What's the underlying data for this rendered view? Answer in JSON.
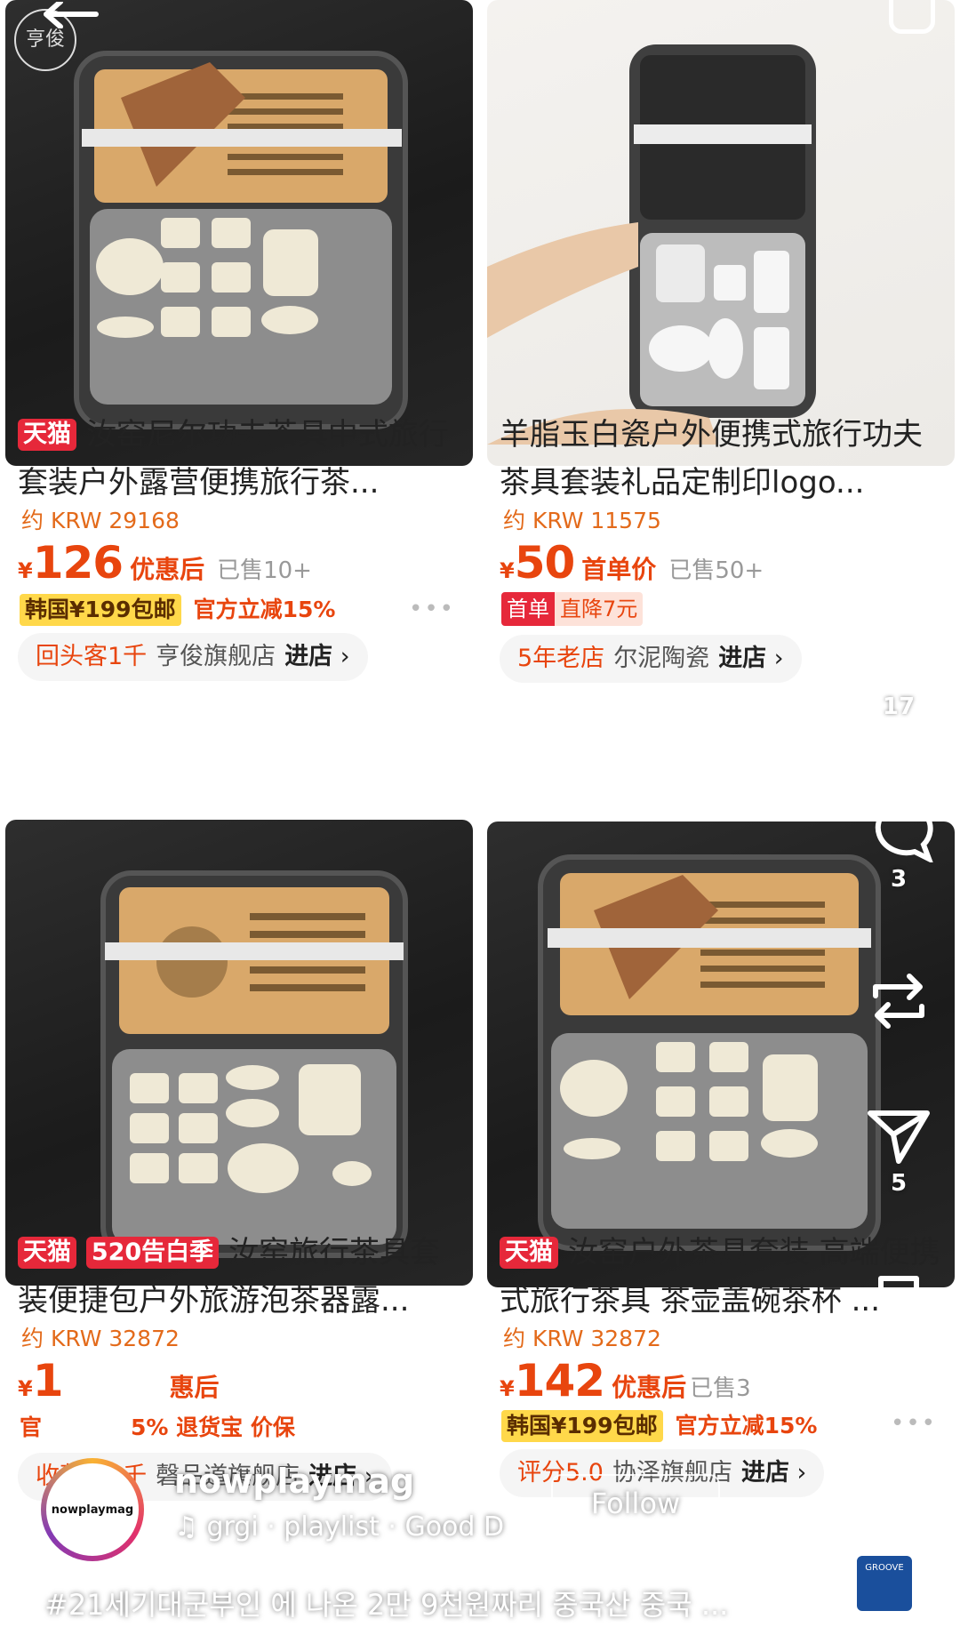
{
  "products": [
    {
      "badges": [
        "天猫"
      ],
      "title": "汝窑尼尔功夫茶具中式旅行套装户外露营便携旅行茶...",
      "krw": "约 KRW 29168",
      "price": "126",
      "price_label": "优惠后",
      "sold": "已售10+",
      "promo_tag": "韩国¥199包邮",
      "promo_text": "官方立减15%",
      "store_badge": "回头客1千",
      "store_name": "亨俊旗舰店",
      "store_enter": "进店",
      "photo": "dark"
    },
    {
      "badges": [],
      "title": "羊脂玉白瓷户外便携式旅行功夫茶具套装礼品定制印logo...",
      "krw": "约 KRW 11575",
      "price": "50",
      "price_label": "首单价",
      "sold": "已售50+",
      "new_tag_a": "首单",
      "new_tag_b": "直降7元",
      "store_badge": "5年老店",
      "store_name": "尔泥陶瓷",
      "store_enter": "进店",
      "photo": "light"
    },
    {
      "badges": [
        "天猫",
        "520告白季"
      ],
      "title": "汝窑旅行茶具套装便捷包户外旅游泡茶器露...",
      "krw": "约 KRW 32872",
      "price": "1",
      "price_label": "惠后",
      "sold": "",
      "promo_tag": "官",
      "promo_text": "5% 退货宝 价保",
      "store_badge": "收藏数5千",
      "store_name": "磬品道旗舰店",
      "store_enter": "进店",
      "photo": "dark"
    },
    {
      "badges": [
        "天猫"
      ],
      "title": "汝窑户外茶具套装 高端便携式旅行茶具 茶壶盖碗茶杯 ...",
      "krw": "约 KRW 32872",
      "price": "142",
      "price_label": "优惠后",
      "sold": "已售3",
      "promo_tag": "韩国¥199包邮",
      "promo_text": "官方立减15%",
      "store_badge": "评分5.0",
      "store_name": "协泽旗舰店",
      "store_enter": "进店",
      "photo": "dark"
    }
  ],
  "overlay": {
    "likes": "17",
    "comments": "3",
    "shares": "5",
    "username": "nowplaymag",
    "avatar_text": "nowplaymag",
    "follow": "Follow",
    "music": "grgi · playlist · Good D",
    "caption": "#21세기대군부인 에 나온 2만 9천원짜리 중국산 중국 ...",
    "store_logo_text": "亨俊",
    "album_text": "GROOVE"
  },
  "colors": {
    "accent_orange": "#e8450e",
    "tmall_red": "#e6283a",
    "promo_yellow": "#ffd84a"
  }
}
